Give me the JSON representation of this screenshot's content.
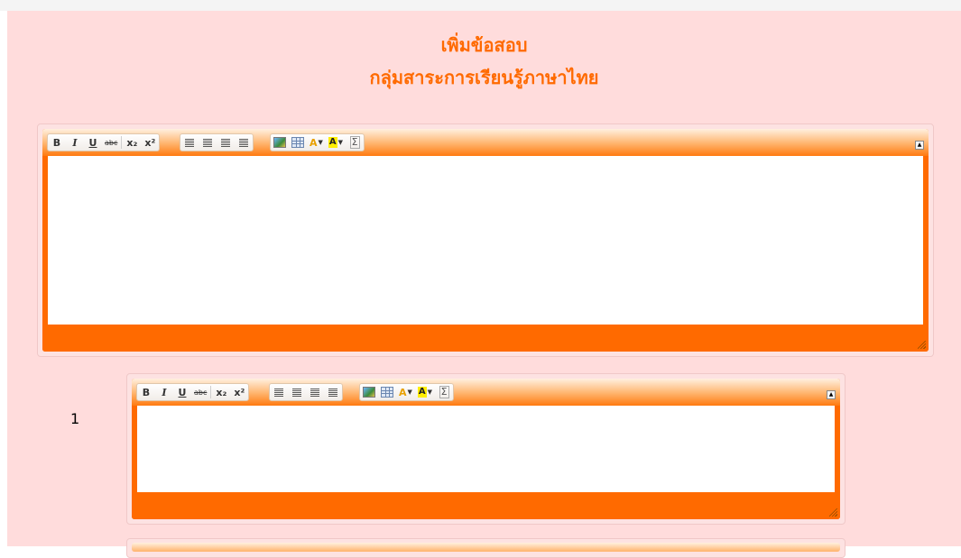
{
  "page": {
    "title_line1": "เพิ่มข้อสอบ",
    "title_line2": "กลุ่มสาระการเรียนรู้ภาษาไทย"
  },
  "toolbar": {
    "bold": "B",
    "italic": "I",
    "underline": "U",
    "strikethrough": "abc",
    "subscript": "x₂",
    "superscript": "x²",
    "sigma": "Σ",
    "font_color": "A",
    "back_color": "A",
    "collapse": "▲"
  },
  "choices": [
    {
      "number": "1"
    }
  ],
  "colors": {
    "page_background": "#ffdcdc",
    "title": "#ff6a00",
    "editor_frame": "#ff6a00"
  },
  "icons": {
    "align_left": "align-left-icon",
    "align_center": "align-center-icon",
    "align_right": "align-right-icon",
    "align_justify": "align-justify-icon",
    "image": "image-icon",
    "table": "table-icon",
    "font_color": "font-color-icon",
    "back_color": "highlight-color-icon",
    "math": "sigma-icon",
    "resize": "resize-grip-icon"
  }
}
